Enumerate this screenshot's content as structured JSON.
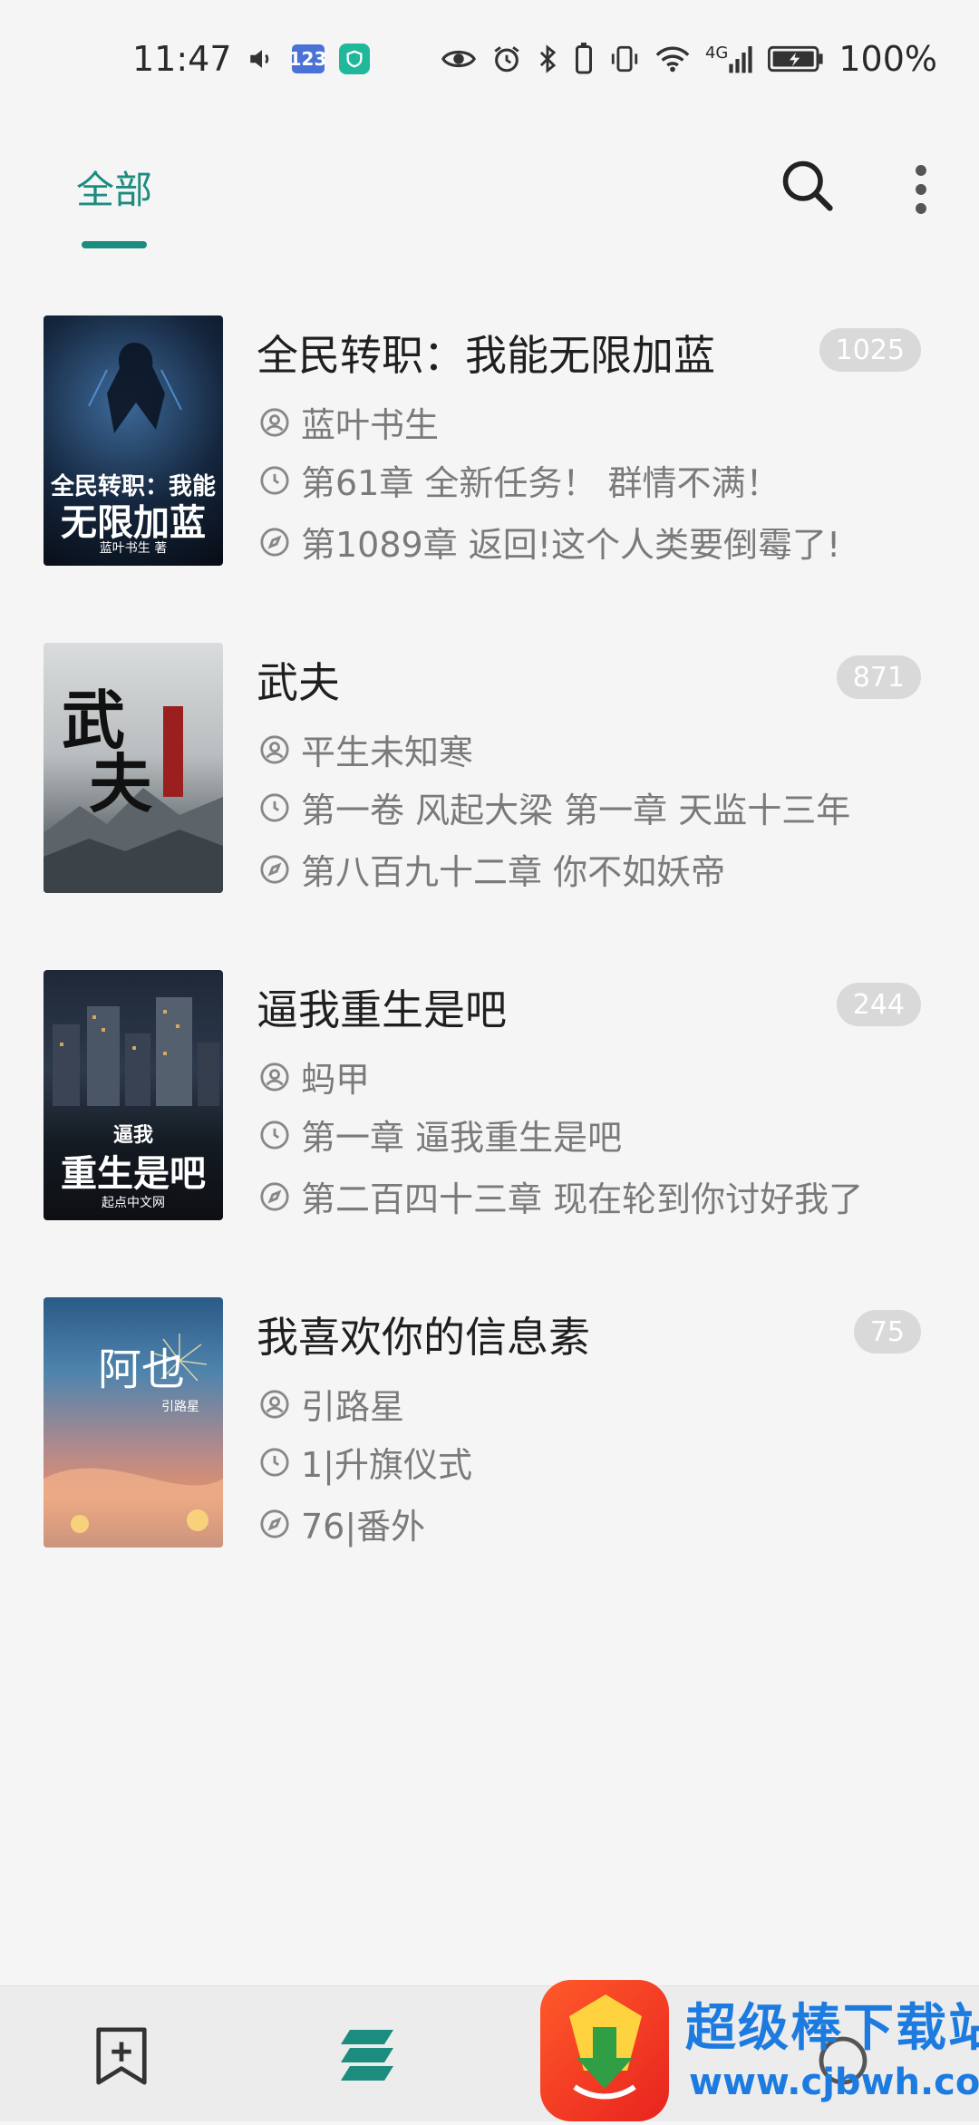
{
  "status_bar": {
    "time": "11:47",
    "badge_123": "123",
    "network": "4G",
    "battery": "100%",
    "icons": [
      "volume-icon",
      "numpad-badge-icon",
      "shield-app-icon",
      "eye-icon",
      "alarm-icon",
      "bluetooth-icon",
      "battery-saver-icon",
      "vibrate-icon",
      "wifi-icon",
      "signal-icon",
      "battery-charging-icon"
    ]
  },
  "header": {
    "tab_all": "全部",
    "accent_color": "#1c8c7f",
    "icons": [
      "search-icon",
      "more-vertical-icon"
    ]
  },
  "books": [
    {
      "title": "全民转职：我能无限加蓝",
      "count": "1025",
      "author": "蓝叶书生",
      "read_chapter": "第61章 全新任务！ 群情不满！",
      "latest_chapter": "第1089章 返回!这个人类要倒霉了!",
      "cover": {
        "line1": "全民转职：我能",
        "line2": "无限加蓝",
        "line3": "蓝叶书生 著"
      }
    },
    {
      "title": "武夫",
      "count": "871",
      "author": "平生未知寒",
      "read_chapter": "第一卷 风起大梁 第一章 天监十三年",
      "latest_chapter": "第八百九十二章 你不如妖帝",
      "cover": {
        "line1": "武",
        "line2": "夫"
      }
    },
    {
      "title": "逼我重生是吧",
      "count": "244",
      "author": "蚂甲",
      "read_chapter": "第一章 逼我重生是吧",
      "latest_chapter": "第二百四十三章 现在轮到你讨好我了",
      "cover": {
        "line1": "逼我",
        "line2": "重生是吧",
        "line3": "起点中文网"
      }
    },
    {
      "title": "我喜欢你的信息素",
      "count": "75",
      "author": "引路星",
      "read_chapter": "1|升旗仪式",
      "latest_chapter": "76|番外",
      "cover": {
        "line1": "阿也",
        "line2": "引路星"
      }
    }
  ],
  "row_icons": [
    "author-icon",
    "clock-icon",
    "compass-icon"
  ],
  "bottom_nav": {
    "icons": [
      "bookmark-add-icon",
      "bookshelf-icon",
      "third-nav-icon"
    ]
  },
  "watermark": {
    "title": "超级棒下载站",
    "url": "www.cjbwh.com"
  }
}
